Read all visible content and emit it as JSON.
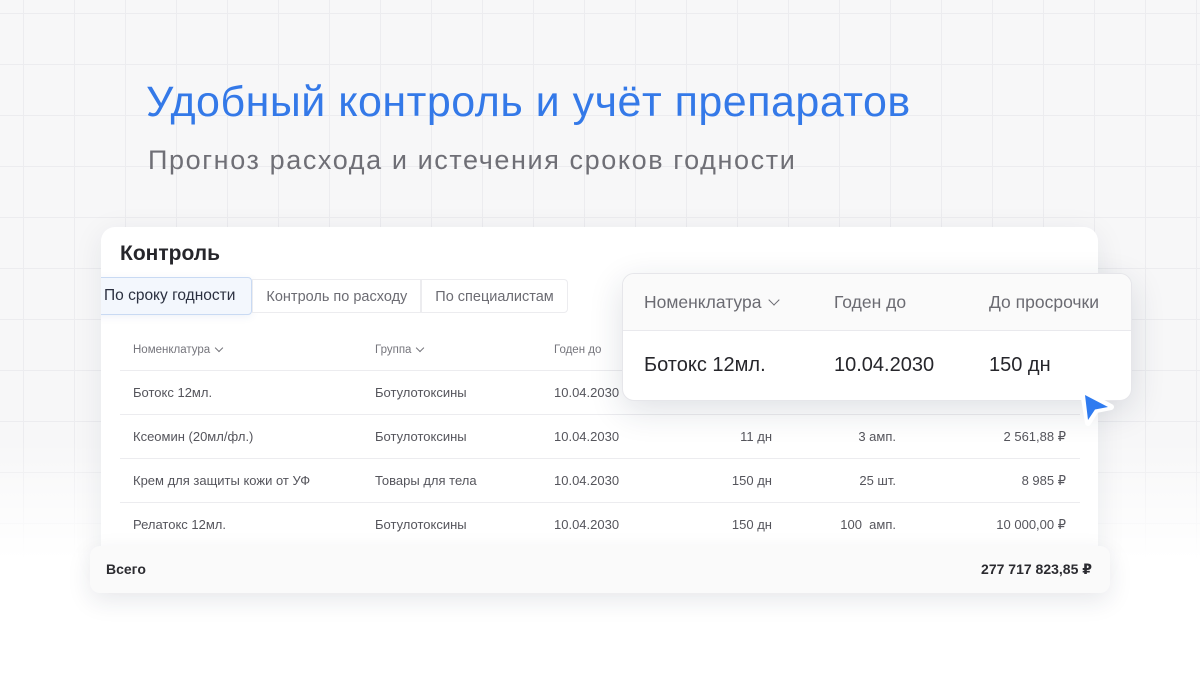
{
  "hero": {
    "title": "Удобный контроль и учёт препаратов",
    "subtitle": "Прогноз расхода и истечения сроков годности"
  },
  "card": {
    "title": "Контроль",
    "tabs": [
      "По сроку годности",
      "Контроль по расходу",
      "По специалистам"
    ],
    "active_tab": "По сроку годности",
    "columns": [
      "Номенклатура",
      "Группа",
      "Годен до"
    ],
    "rows": [
      {
        "name": "Ботокс 12мл.",
        "group": "Ботулотоксины",
        "date": "10.04.2030",
        "days": "",
        "qty": "",
        "sum": ""
      },
      {
        "name": "Ксеомин (20мл/фл.)",
        "group": "Ботулотоксины",
        "date": "10.04.2030",
        "days": "11 дн",
        "qty": "3 амп.",
        "sum": "2 561,88 ₽"
      },
      {
        "name": "Крем для защиты кожи от УФ",
        "group": "Товары для тела",
        "date": "10.04.2030",
        "days": "150 дн",
        "qty": "25 шт.",
        "sum": "8 985 ₽"
      },
      {
        "name": "Релатокс 12мл.",
        "group": "Ботулотоксины",
        "date": "10.04.2030",
        "days": "150 дн",
        "qty": "100  амп.",
        "sum": "10 000,00 ₽"
      }
    ]
  },
  "total": {
    "label": "Всего",
    "value": "277 717 823,85 ₽"
  },
  "popup": {
    "columns": [
      "Номенклатура",
      "Годен до",
      "До просрочки"
    ],
    "row": {
      "name": "Ботокс 12мл.",
      "date": "10.04.2030",
      "days": "150 дн"
    }
  },
  "colors": {
    "accent": "#3479e8",
    "cursor": "#2f7bf0"
  },
  "icons": [
    "chevron-down-icon",
    "cursor-pointer-icon"
  ]
}
